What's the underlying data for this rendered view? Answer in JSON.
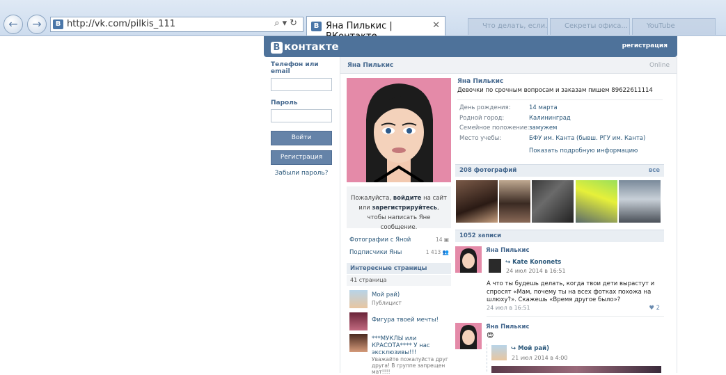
{
  "browser": {
    "url": "http://vk.com/pilkis_111",
    "tab_title": "Яна Пилькис | ВКонтакте",
    "back_glyph": "←",
    "forward_glyph": "→",
    "address_tools": "⌕▾↻",
    "close_glyph": "✕",
    "ghost_tabs": [
      "Что делать, если...",
      "Секреты офиса...",
      "YouTube"
    ]
  },
  "header": {
    "logo_letter": "В",
    "logo_text": "контакте",
    "register_link": "регистрация"
  },
  "login": {
    "phone_label": "Телефон или email",
    "password_label": "Пароль",
    "login_button": "Войти",
    "register_button": "Регистрация",
    "forgot_link": "Забыли пароль?"
  },
  "profile": {
    "name": "Яна Пилькис",
    "online": "Online",
    "status": "Девочки по срочным вопросам и заказам пишем 89622611114",
    "fields": [
      {
        "key": "День рождения:",
        "value": "14 марта"
      },
      {
        "key": "Родной город:",
        "value": "Калининград"
      },
      {
        "key": "Семейное положение:",
        "value": "замужем"
      },
      {
        "key": "Место учебы:",
        "value": "БФУ им. Канта (бывш. РГУ им. Канта)"
      }
    ],
    "more_info": "Показать подробную информацию"
  },
  "sidebar": {
    "invite_part1": "Пожалуйста, ",
    "invite_bold1": "войдите",
    "invite_part2": " на сайт или ",
    "invite_bold2": "зарегистрируйтесь",
    "invite_part3": ", чтобы написать Яне сообщение.",
    "photos_with": "Фотографии с Яной",
    "photos_with_count": "14",
    "followers": "Подписчики Яны",
    "followers_count": "1 413",
    "interesting_title": "Интересные страницы",
    "interesting_count": "41 страница",
    "pages": [
      {
        "title": "Мой рай)",
        "sub": "Публицист"
      },
      {
        "title": "Фигура твоей мечты!",
        "sub": ""
      },
      {
        "title": "***МУКЛЫ или КРАСОТА**** У нас эксклюзивы!!!",
        "sub": "Уважайте пожалуйста друг друга! В группе запрещен мат!!!!"
      }
    ]
  },
  "photos": {
    "header": "208 фотографий",
    "all": "все"
  },
  "wall": {
    "header": "1052 записи",
    "posts": [
      {
        "author": "Яна Пилькис",
        "repost_name": "Kate Kononets",
        "repost_date": "24 июл 2014 в 16:51",
        "text": "А что ты будешь делать, когда твои дети вырастут и спросят «Мам, почему ты на всех фотках похожа на шлюху?». Скажешь «Время другое было»?",
        "date": "24 июл в 16:51",
        "likes": "2"
      },
      {
        "author": "Яна Пилькис",
        "emoji": "😍",
        "repost_name": "Мой рай)",
        "repost_date": "21 июл 2014 в 4:00"
      }
    ]
  },
  "colors": {
    "brand": "#4e729a",
    "link": "#2b587a",
    "accent": "#45688e"
  }
}
